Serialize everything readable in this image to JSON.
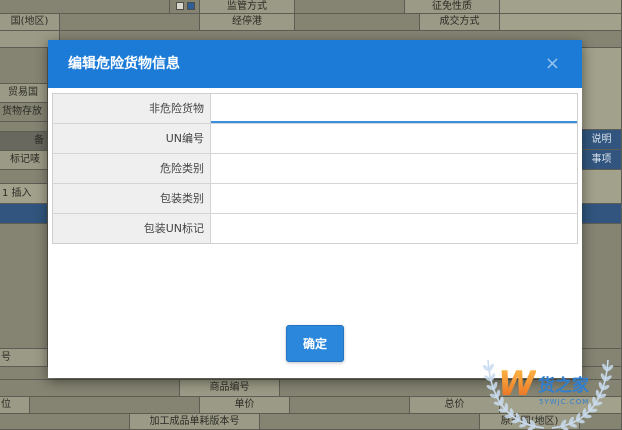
{
  "background": {
    "top": {
      "supervision_mode": "监管方式",
      "exemption_nature": "征免性质",
      "country_region": "国(地区)",
      "stop_port": "经停港",
      "transaction_mode": "成交方式"
    },
    "left": {
      "trade_country": "贸易国",
      "storage_place": "货物存放",
      "remark": "备",
      "marks": "标记唛",
      "insert_row": "1 插入",
      "item_no": "号"
    },
    "right": {
      "explain": "说明",
      "matters": "事项"
    },
    "bottom": {
      "goods_code": "商品编号",
      "unit": "位",
      "unit_price": "单价",
      "total_price": "总价",
      "consumption_version": "加工成品单耗版本号",
      "origin_country": "原产国(地区)"
    }
  },
  "modal": {
    "title": "编辑危险货物信息",
    "close_glyph": "×",
    "fields": [
      {
        "label": "非危险货物"
      },
      {
        "label": "UN编号"
      },
      {
        "label": "危险类别"
      },
      {
        "label": "包装类别"
      },
      {
        "label": "包装UN标记"
      }
    ],
    "confirm_label": "确定"
  },
  "logo": {
    "mark": "W",
    "name": "货之家",
    "url": "5YWJC.COM"
  },
  "icons": {
    "close": "close-icon",
    "checkbox": "checkbox-icon",
    "wreath": "laurel-wreath-icon"
  },
  "colors": {
    "header": "#1c7bd6",
    "button": "#2b87dc",
    "focus": "#3a8fe0",
    "backdrop": "#6f6f64",
    "logo_orange": "#f0892a",
    "logo_blue": "#2f7fd0"
  }
}
